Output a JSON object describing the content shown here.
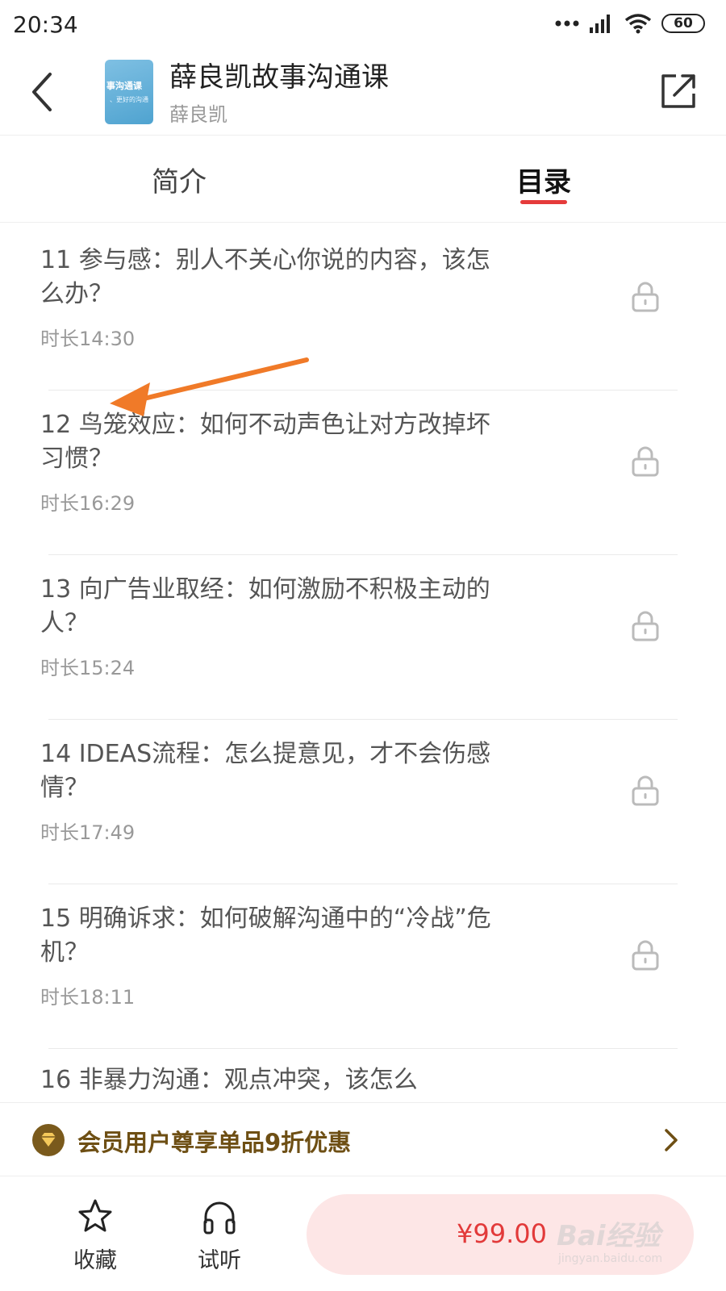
{
  "status_bar": {
    "time": "20:34",
    "battery": "60"
  },
  "header": {
    "cover_text": "事沟通课",
    "cover_subtext": "、更好的沟通",
    "title": "薛良凯故事沟通课",
    "author": "薛良凯"
  },
  "tabs": [
    {
      "label": "简介",
      "active": false
    },
    {
      "label": "目录",
      "active": true
    }
  ],
  "accent_color": "#e53b3b",
  "lessons": [
    {
      "title": "11 参与感：别人不关心你说的内容，该怎么办？",
      "duration": "时长14:30",
      "locked": true
    },
    {
      "title": "12 鸟笼效应：如何不动声色让对方改掉坏习惯？",
      "duration": "时长16:29",
      "locked": true
    },
    {
      "title": "13 向广告业取经：如何激励不积极主动的人？",
      "duration": "时长15:24",
      "locked": true
    },
    {
      "title": "14 IDEAS流程：怎么提意见，才不会伤感情？",
      "duration": "时长17:49",
      "locked": true
    },
    {
      "title": "15 明确诉求：如何破解沟通中的“冷战”危机？",
      "duration": "时长18:11",
      "locked": true
    },
    {
      "title": "16 非暴力沟通：观点冲突，该怎么",
      "duration": "",
      "locked": true
    }
  ],
  "member_banner": {
    "text": "会员用户尊享单品9折优惠"
  },
  "bottom_bar": {
    "favorite_label": "收藏",
    "listen_label": "试听",
    "price": "¥99.00"
  },
  "watermark": {
    "main": "Bai经验",
    "sub": "jingyan.baidu.com"
  }
}
